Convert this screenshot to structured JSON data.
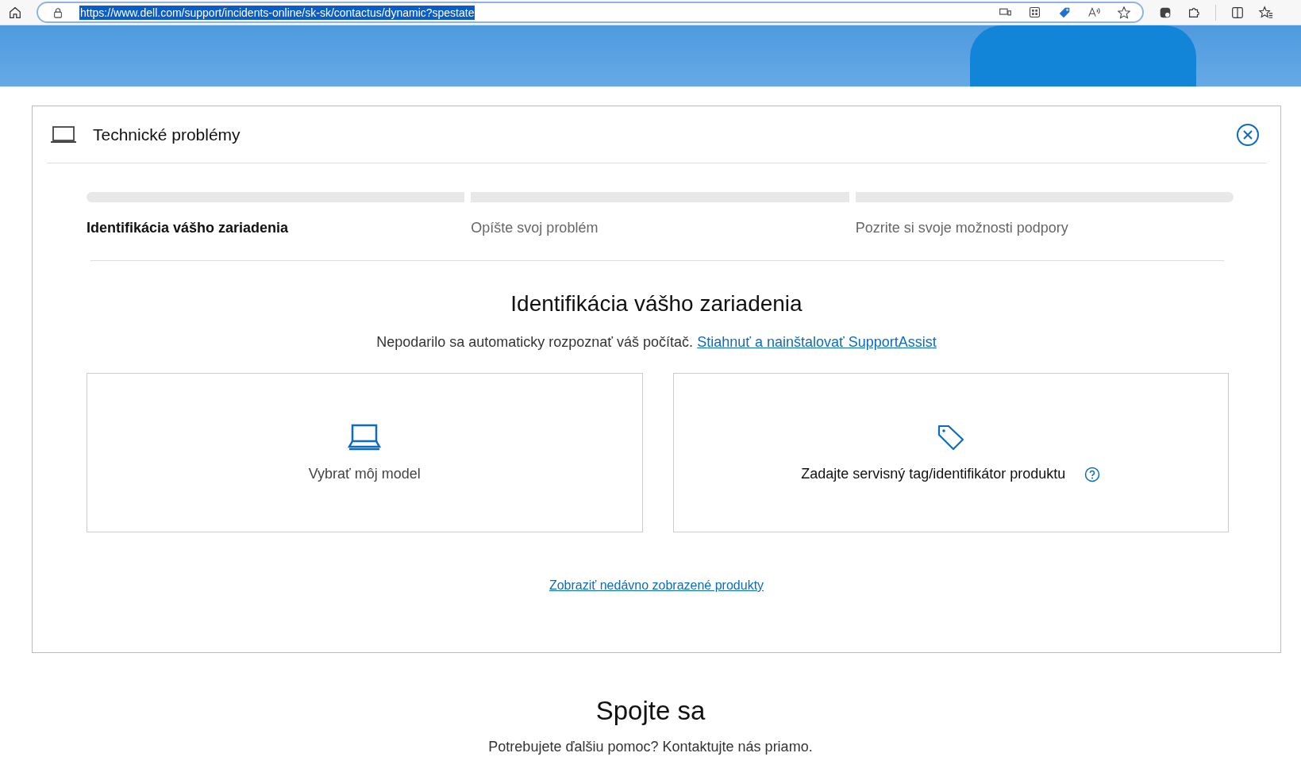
{
  "browser": {
    "url": "https://www.dell.com/support/incidents-online/sk-sk/contactus/dynamic?spestate"
  },
  "panel": {
    "title": "Technické problémy",
    "steps": [
      {
        "label": "Identifikácia vášho zariadenia",
        "selected": true
      },
      {
        "label": "Opíšte svoj problém",
        "selected": false
      },
      {
        "label": "Pozrite si svoje možnosti podpory",
        "selected": false
      }
    ],
    "heading": "Identifikácia vášho zariadenia",
    "message": "Nepodarilo sa automaticky rozpoznať váš počítač.",
    "message_link": "Stiahnuť a nainštalovať SupportAssist",
    "options": [
      {
        "kind": "model",
        "label": "Vybrať môj model"
      },
      {
        "kind": "tag",
        "label": "Zadajte servisný tag/identifikátor produktu"
      }
    ],
    "recent_link": "Zobraziť nedávno zobrazené produkty"
  },
  "contact": {
    "heading": "Spojte sa",
    "text": "Potrebujete ďalšiu pomoc? Kontaktujte nás priamo."
  }
}
